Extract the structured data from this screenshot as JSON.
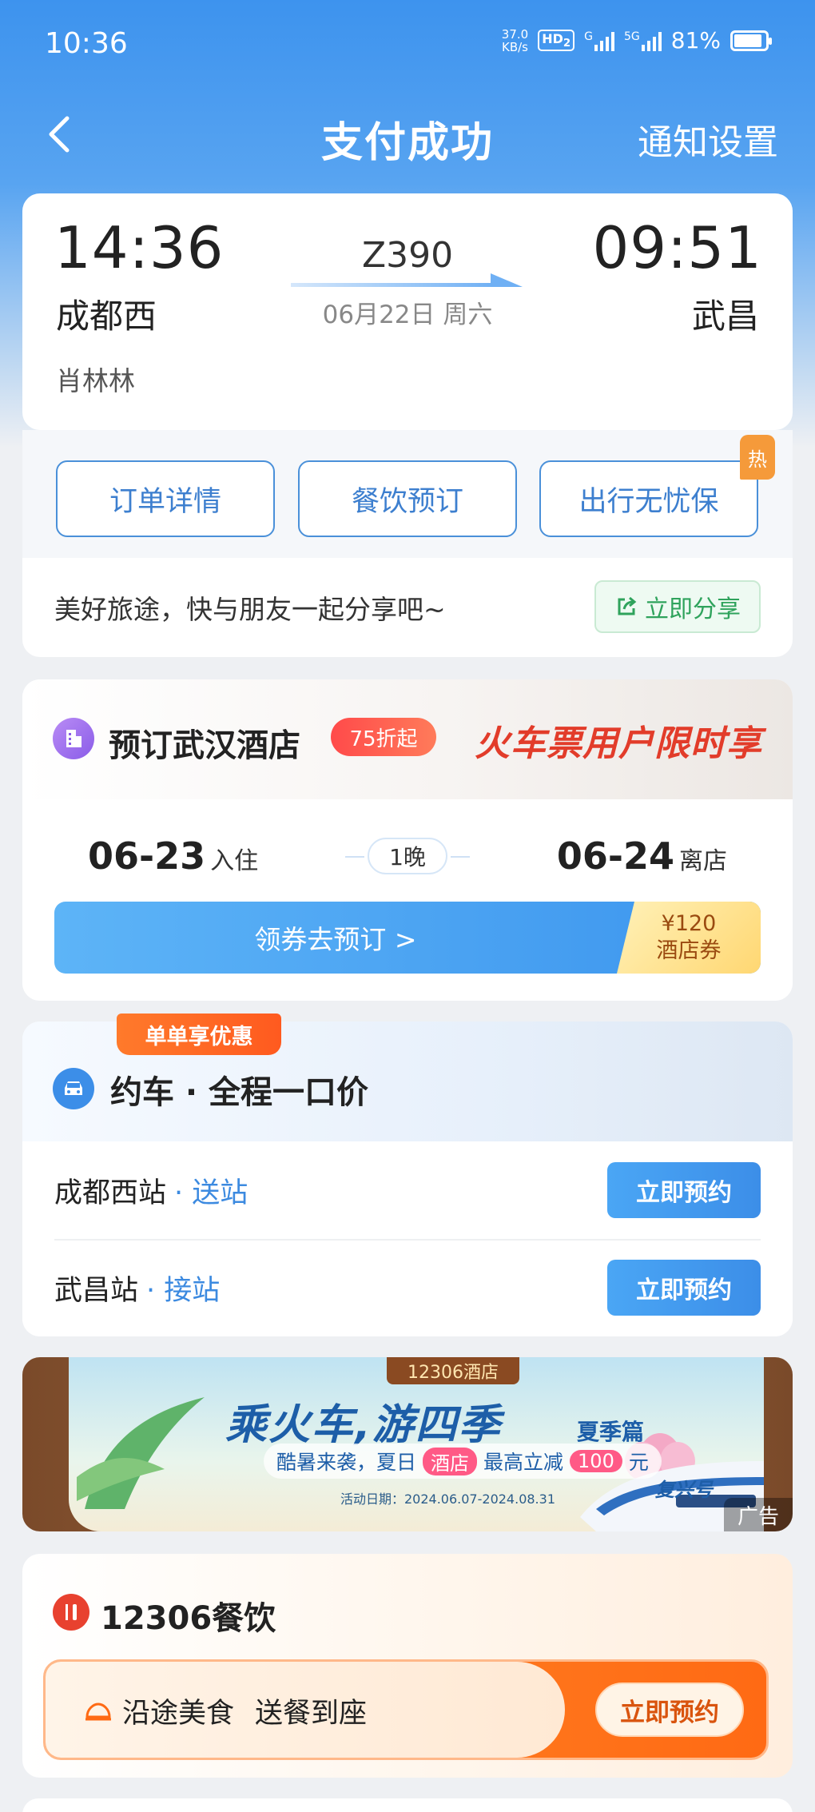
{
  "status_bar": {
    "time": "10:36",
    "net_speed_value": "37.0",
    "net_speed_unit": "KB/s",
    "hd": "HD",
    "hd_sub": "2",
    "signal1_tag": "G",
    "signal2_tag": "5G",
    "battery": "81%"
  },
  "nav": {
    "title": "支付成功",
    "settings": "通知设置"
  },
  "ticket": {
    "departure_time": "14:36",
    "departure_station": "成都西",
    "train_number": "Z390",
    "date": "06月22日 周六",
    "arrival_time": "09:51",
    "arrival_station": "武昌",
    "passenger": "肖林林"
  },
  "actions": [
    {
      "label": "订单详情"
    },
    {
      "label": "餐饮预订"
    },
    {
      "label": "出行无忧保",
      "badge": "热"
    }
  ],
  "share": {
    "text": "美好旅途，快与朋友一起分享吧~",
    "button": "立即分享"
  },
  "hotel": {
    "title": "预订武汉酒店",
    "discount": "75折起",
    "promo": "火车票用户限时享",
    "checkin_date": "06-23",
    "checkin_label": "入住",
    "nights": "1晚",
    "checkout_date": "06-24",
    "checkout_label": "离店",
    "book_label": "领券去预订 >",
    "coupon_amount": "¥120",
    "coupon_label": "酒店券"
  },
  "ride": {
    "tag": "单单享优惠",
    "title": "约车 · 全程一口价",
    "rows": [
      {
        "station": "成都西站",
        "type": "· 送站",
        "button": "立即预约"
      },
      {
        "station": "武昌站",
        "type": "· 接站",
        "button": "立即预约"
      }
    ]
  },
  "banner": {
    "brand": "12306酒店",
    "title": "乘火车,游四季",
    "season": "夏季篇",
    "sub_1": "酷暑来袭，夏日",
    "sub_pill_1": "酒店",
    "sub_2": "最高立减",
    "sub_pill_2": "100",
    "sub_3": "元",
    "period": "活动日期：2024.06.07-2024.08.31",
    "train_name": "复兴号",
    "ad_label": "广告"
  },
  "food": {
    "title": "12306餐饮",
    "text_1": "沿途美食",
    "text_2": "送餐到座",
    "button": "立即预约"
  },
  "colors": {
    "primary_blue": "#3d93ee",
    "accent_orange": "#ff6a14",
    "promo_red": "#e23c2a",
    "share_green": "#2fa35c"
  }
}
